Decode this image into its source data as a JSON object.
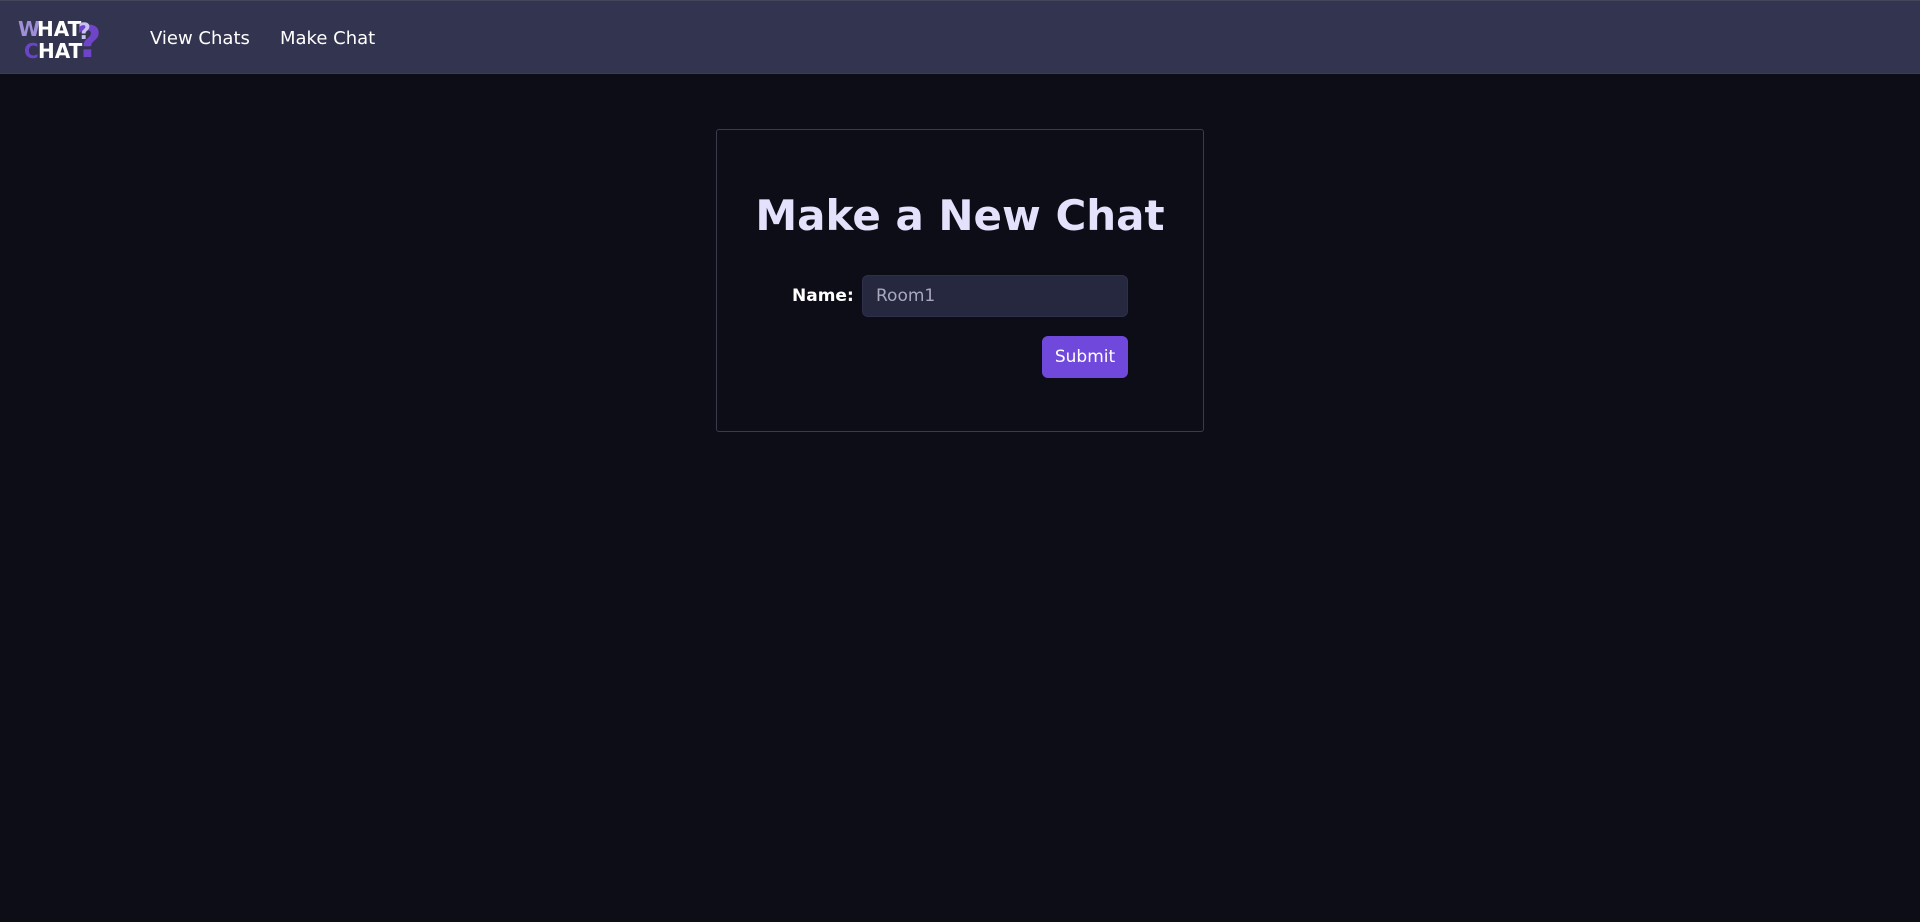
{
  "app": {
    "logo_text": "WHAT CHAT?",
    "logo_icon": "question-mark-logo"
  },
  "nav": {
    "items": [
      {
        "label": "View Chats"
      },
      {
        "label": "Make Chat"
      }
    ]
  },
  "form": {
    "title": "Make a New Chat",
    "name_label": "Name:",
    "name_placeholder": "Room1",
    "name_value": "",
    "submit_label": "Submit"
  },
  "colors": {
    "background": "#0c0d16",
    "navbar": "#33344f",
    "accent": "#7049dc",
    "input_bg": "#262840",
    "title": "#e3e1fb"
  }
}
